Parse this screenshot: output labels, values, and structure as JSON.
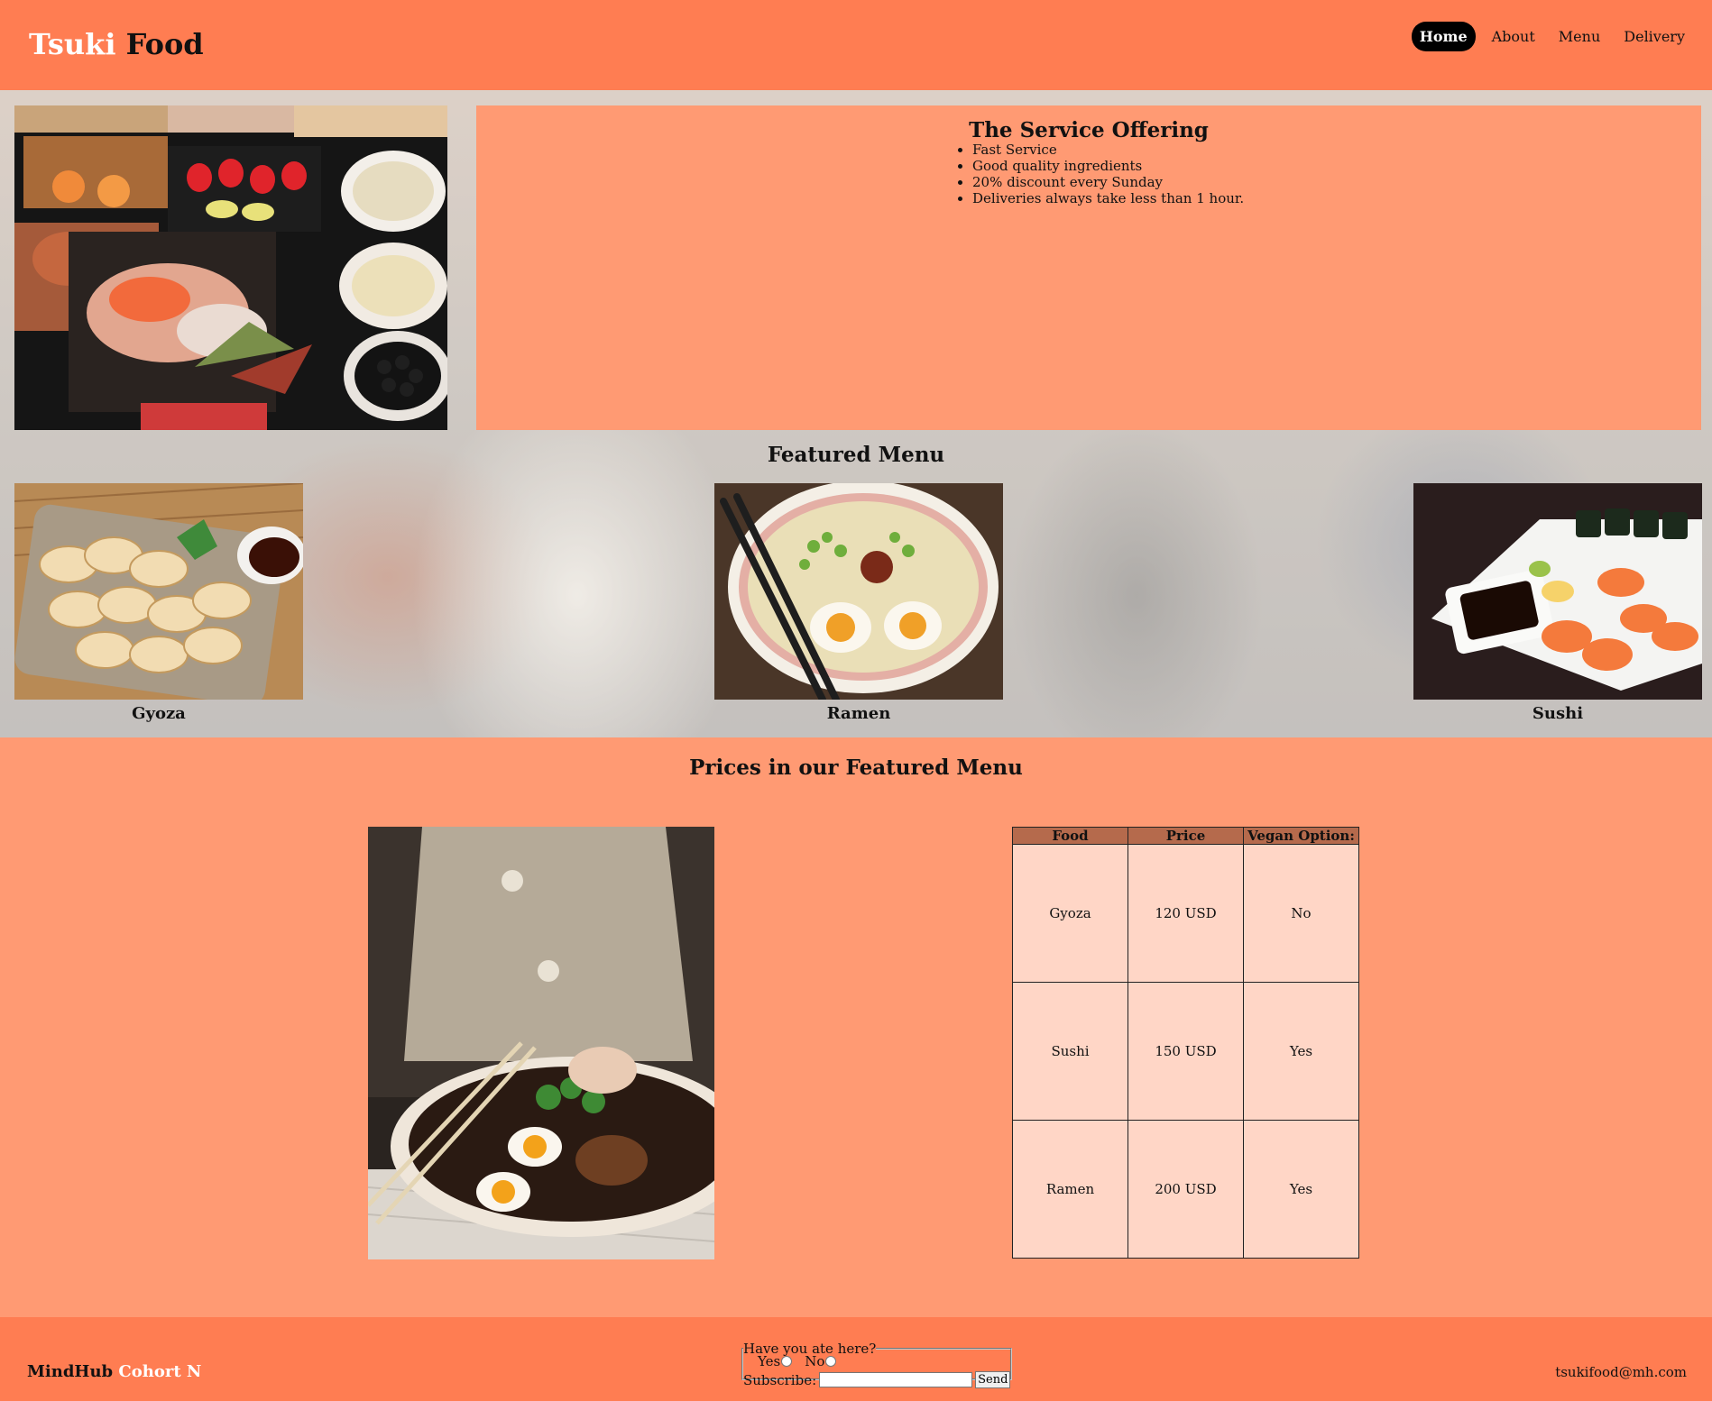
{
  "header": {
    "brand_first": "Tsuki",
    "brand_second": "Food",
    "nav": [
      "Home",
      "About",
      "Menu",
      "Delivery"
    ],
    "active_nav": "Home"
  },
  "offering": {
    "title": "The Service Offering",
    "items": [
      "Fast Service",
      "Good quality ingredients",
      "20% discount every Sunday",
      "Deliveries always take less than 1 hour."
    ]
  },
  "featured": {
    "title": "Featured Menu",
    "dishes": [
      "Gyoza",
      "Ramen",
      "Sushi"
    ]
  },
  "prices": {
    "title": "Prices in our Featured Menu",
    "headers": [
      "Food",
      "Price",
      "Vegan Option:"
    ],
    "rows": [
      [
        "Gyoza",
        "120 USD",
        "No"
      ],
      [
        "Sushi",
        "150 USD",
        "Yes"
      ],
      [
        "Ramen",
        "200 USD",
        "Yes"
      ]
    ]
  },
  "footer": {
    "org_first": "MindHub",
    "org_second": "Cohort N",
    "survey_legend": "Have you ate here?",
    "survey_yes": "Yes",
    "survey_no": "No",
    "subscribe_label": "Subscribe:",
    "subscribe_value": "",
    "send_label": "Send",
    "email": "tsukifood@mh.com"
  },
  "colors": {
    "header_bg": "#ff7d52",
    "page_bg": "#ff9a73",
    "table_header": "#b56a4c",
    "table_cell": "#ffd6c6"
  }
}
